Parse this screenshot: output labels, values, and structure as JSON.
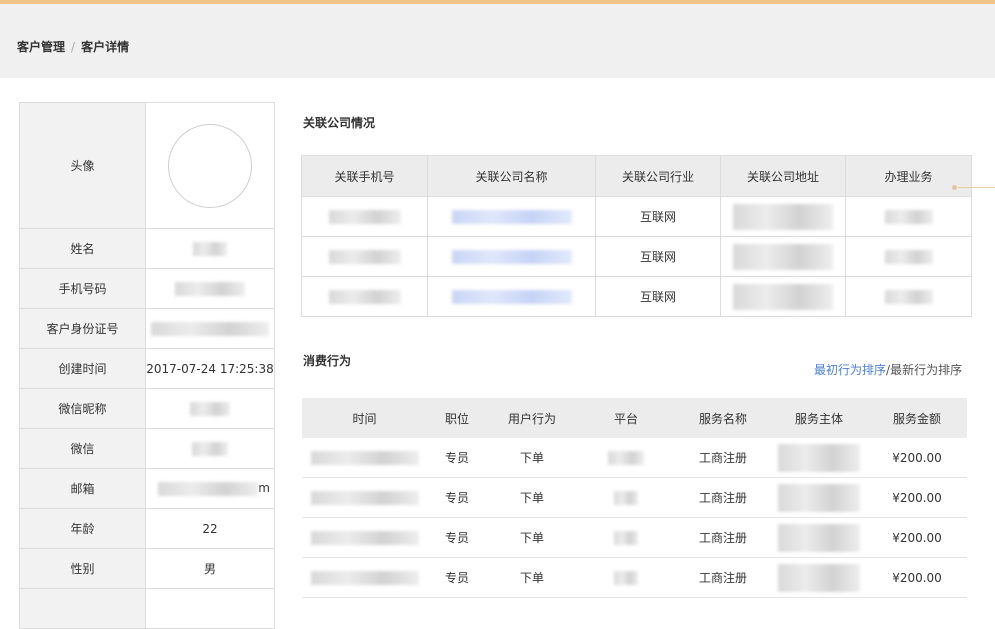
{
  "breadcrumb": {
    "items": [
      "客户管理",
      "客户详情"
    ],
    "separator": "/"
  },
  "profile": {
    "rows": [
      {
        "label": "头像",
        "value": ""
      },
      {
        "label": "姓名",
        "value": ""
      },
      {
        "label": "手机号码",
        "value": ""
      },
      {
        "label": "客户身份证号",
        "value": ""
      },
      {
        "label": "创建时间",
        "value": "2017-07-24 17:25:38"
      },
      {
        "label": "微信昵称",
        "value": ""
      },
      {
        "label": "微信",
        "value": ""
      },
      {
        "label": "邮箱",
        "value": "m"
      },
      {
        "label": "年龄",
        "value": "22"
      },
      {
        "label": "性别",
        "value": "男"
      }
    ]
  },
  "related": {
    "title": "关联公司情况",
    "headers": [
      "关联手机号",
      "关联公司名称",
      "关联公司行业",
      "关联公司地址",
      "办理业务"
    ],
    "industry": [
      "互联网",
      "互联网",
      "互联网"
    ]
  },
  "consumption": {
    "title": "消费行为",
    "sort_first": "最初行为排序",
    "sort_sep": "/",
    "sort_latest": "最新行为排序",
    "headers": [
      "时间",
      "职位",
      "用户行为",
      "平台",
      "服务名称",
      "服务主体",
      "服务金额"
    ],
    "rows": [
      {
        "position": "专员",
        "action": "下单",
        "service": "工商注册",
        "amount": "¥200.00"
      },
      {
        "position": "专员",
        "action": "下单",
        "service": "工商注册",
        "amount": "¥200.00"
      },
      {
        "position": "专员",
        "action": "下单",
        "service": "工商注册",
        "amount": "¥200.00"
      },
      {
        "position": "专员",
        "action": "下单",
        "service": "工商注册",
        "amount": "¥200.00"
      }
    ]
  },
  "colors": {
    "accent_bar": "#f0c48a",
    "link": "#4a7fd6",
    "header_bg": "#ececec"
  }
}
